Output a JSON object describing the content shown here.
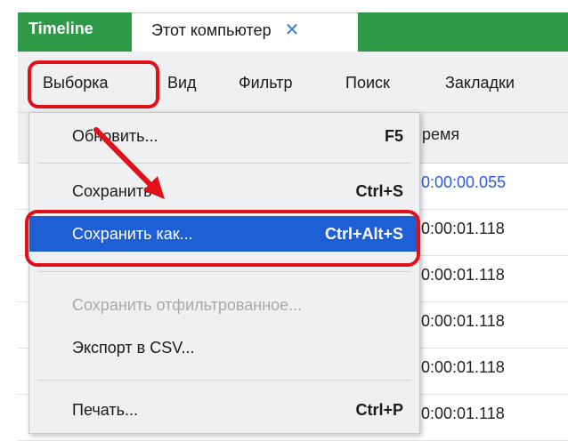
{
  "tabs": {
    "timeline": "Timeline",
    "active": "Этот компьютер",
    "close_glyph": "✕"
  },
  "menubar": {
    "items": [
      "Выборка",
      "Вид",
      "Фильтр",
      "Поиск",
      "Закладки"
    ]
  },
  "table": {
    "header_partial": "ремя",
    "times": [
      "0:00:00.055",
      "0:00:01.118",
      "0:00:01.118",
      "0:00:01.118",
      "0:00:01.118",
      "0:00:01.118"
    ]
  },
  "dropdown": {
    "refresh": {
      "label": "Обновить...",
      "shortcut": "F5"
    },
    "save": {
      "label": "Сохранить",
      "shortcut": "Ctrl+S"
    },
    "save_as": {
      "label": "Сохранить как...",
      "shortcut": "Ctrl+Alt+S"
    },
    "save_filtered": {
      "label": "Сохранить отфильтрованное...",
      "shortcut": ""
    },
    "export_csv": {
      "label": "Экспорт в CSV...",
      "shortcut": ""
    },
    "print": {
      "label": "Печать...",
      "shortcut": "Ctrl+P"
    }
  },
  "colors": {
    "accent_green": "#2e9a48",
    "highlight_blue": "#1f5fd6",
    "annotation_red": "#e2101a",
    "link_blue": "#2b5be0"
  },
  "icons": {
    "tab_close": "close-icon",
    "annotation_arrow": "arrow-icon"
  }
}
